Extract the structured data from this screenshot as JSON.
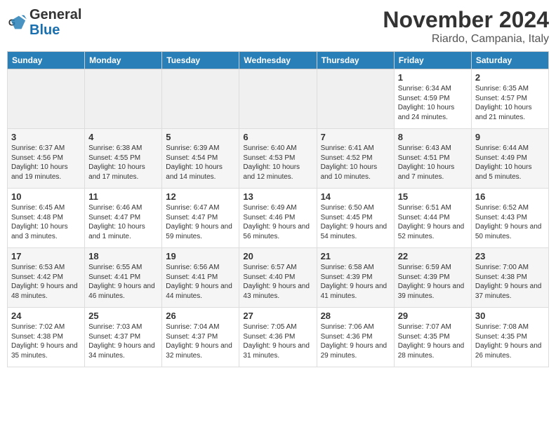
{
  "header": {
    "logo_line1": "General",
    "logo_line2": "Blue",
    "month": "November 2024",
    "location": "Riardo, Campania, Italy"
  },
  "weekdays": [
    "Sunday",
    "Monday",
    "Tuesday",
    "Wednesday",
    "Thursday",
    "Friday",
    "Saturday"
  ],
  "weeks": [
    [
      {
        "day": "",
        "info": ""
      },
      {
        "day": "",
        "info": ""
      },
      {
        "day": "",
        "info": ""
      },
      {
        "day": "",
        "info": ""
      },
      {
        "day": "",
        "info": ""
      },
      {
        "day": "1",
        "info": "Sunrise: 6:34 AM\nSunset: 4:59 PM\nDaylight: 10 hours and 24 minutes."
      },
      {
        "day": "2",
        "info": "Sunrise: 6:35 AM\nSunset: 4:57 PM\nDaylight: 10 hours and 21 minutes."
      }
    ],
    [
      {
        "day": "3",
        "info": "Sunrise: 6:37 AM\nSunset: 4:56 PM\nDaylight: 10 hours and 19 minutes."
      },
      {
        "day": "4",
        "info": "Sunrise: 6:38 AM\nSunset: 4:55 PM\nDaylight: 10 hours and 17 minutes."
      },
      {
        "day": "5",
        "info": "Sunrise: 6:39 AM\nSunset: 4:54 PM\nDaylight: 10 hours and 14 minutes."
      },
      {
        "day": "6",
        "info": "Sunrise: 6:40 AM\nSunset: 4:53 PM\nDaylight: 10 hours and 12 minutes."
      },
      {
        "day": "7",
        "info": "Sunrise: 6:41 AM\nSunset: 4:52 PM\nDaylight: 10 hours and 10 minutes."
      },
      {
        "day": "8",
        "info": "Sunrise: 6:43 AM\nSunset: 4:51 PM\nDaylight: 10 hours and 7 minutes."
      },
      {
        "day": "9",
        "info": "Sunrise: 6:44 AM\nSunset: 4:49 PM\nDaylight: 10 hours and 5 minutes."
      }
    ],
    [
      {
        "day": "10",
        "info": "Sunrise: 6:45 AM\nSunset: 4:48 PM\nDaylight: 10 hours and 3 minutes."
      },
      {
        "day": "11",
        "info": "Sunrise: 6:46 AM\nSunset: 4:47 PM\nDaylight: 10 hours and 1 minute."
      },
      {
        "day": "12",
        "info": "Sunrise: 6:47 AM\nSunset: 4:47 PM\nDaylight: 9 hours and 59 minutes."
      },
      {
        "day": "13",
        "info": "Sunrise: 6:49 AM\nSunset: 4:46 PM\nDaylight: 9 hours and 56 minutes."
      },
      {
        "day": "14",
        "info": "Sunrise: 6:50 AM\nSunset: 4:45 PM\nDaylight: 9 hours and 54 minutes."
      },
      {
        "day": "15",
        "info": "Sunrise: 6:51 AM\nSunset: 4:44 PM\nDaylight: 9 hours and 52 minutes."
      },
      {
        "day": "16",
        "info": "Sunrise: 6:52 AM\nSunset: 4:43 PM\nDaylight: 9 hours and 50 minutes."
      }
    ],
    [
      {
        "day": "17",
        "info": "Sunrise: 6:53 AM\nSunset: 4:42 PM\nDaylight: 9 hours and 48 minutes."
      },
      {
        "day": "18",
        "info": "Sunrise: 6:55 AM\nSunset: 4:41 PM\nDaylight: 9 hours and 46 minutes."
      },
      {
        "day": "19",
        "info": "Sunrise: 6:56 AM\nSunset: 4:41 PM\nDaylight: 9 hours and 44 minutes."
      },
      {
        "day": "20",
        "info": "Sunrise: 6:57 AM\nSunset: 4:40 PM\nDaylight: 9 hours and 43 minutes."
      },
      {
        "day": "21",
        "info": "Sunrise: 6:58 AM\nSunset: 4:39 PM\nDaylight: 9 hours and 41 minutes."
      },
      {
        "day": "22",
        "info": "Sunrise: 6:59 AM\nSunset: 4:39 PM\nDaylight: 9 hours and 39 minutes."
      },
      {
        "day": "23",
        "info": "Sunrise: 7:00 AM\nSunset: 4:38 PM\nDaylight: 9 hours and 37 minutes."
      }
    ],
    [
      {
        "day": "24",
        "info": "Sunrise: 7:02 AM\nSunset: 4:38 PM\nDaylight: 9 hours and 35 minutes."
      },
      {
        "day": "25",
        "info": "Sunrise: 7:03 AM\nSunset: 4:37 PM\nDaylight: 9 hours and 34 minutes."
      },
      {
        "day": "26",
        "info": "Sunrise: 7:04 AM\nSunset: 4:37 PM\nDaylight: 9 hours and 32 minutes."
      },
      {
        "day": "27",
        "info": "Sunrise: 7:05 AM\nSunset: 4:36 PM\nDaylight: 9 hours and 31 minutes."
      },
      {
        "day": "28",
        "info": "Sunrise: 7:06 AM\nSunset: 4:36 PM\nDaylight: 9 hours and 29 minutes."
      },
      {
        "day": "29",
        "info": "Sunrise: 7:07 AM\nSunset: 4:35 PM\nDaylight: 9 hours and 28 minutes."
      },
      {
        "day": "30",
        "info": "Sunrise: 7:08 AM\nSunset: 4:35 PM\nDaylight: 9 hours and 26 minutes."
      }
    ]
  ]
}
